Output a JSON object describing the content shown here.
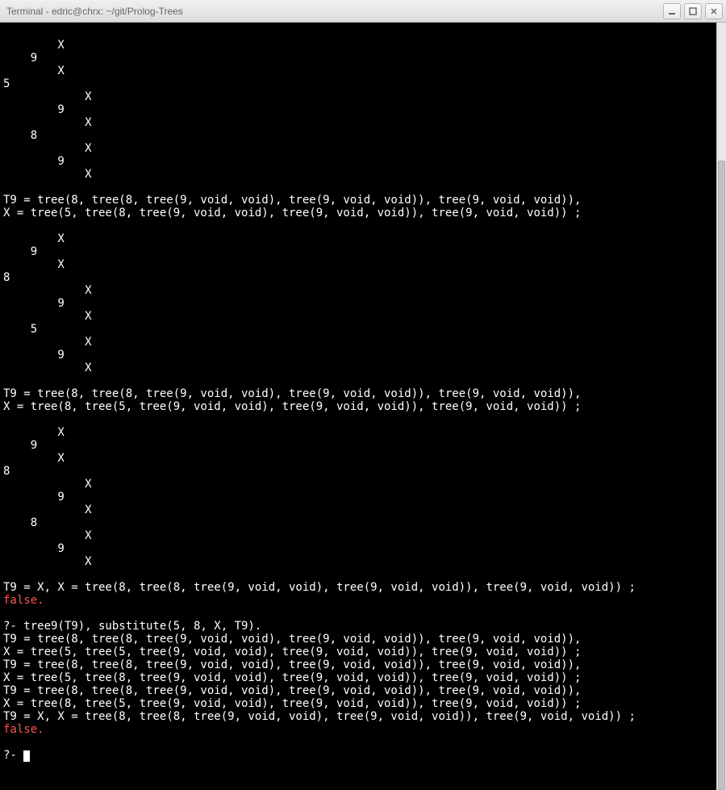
{
  "window": {
    "title": "Terminal - edric@chrx: ~/git/Prolog-Trees"
  },
  "terminal": {
    "prompt": "?- ",
    "false_text": "false.",
    "block1_tree": [
      "        X",
      "    9",
      "        X",
      "5",
      "            X",
      "        9",
      "            X",
      "    8",
      "            X",
      "        9",
      "            X",
      ""
    ],
    "block1_result": [
      "T9 = tree(8, tree(8, tree(9, void, void), tree(9, void, void)), tree(9, void, void)),",
      "X = tree(5, tree(8, tree(9, void, void), tree(9, void, void)), tree(9, void, void)) ;",
      ""
    ],
    "block2_tree": [
      "        X",
      "    9",
      "        X",
      "8",
      "            X",
      "        9",
      "            X",
      "    5",
      "            X",
      "        9",
      "            X",
      ""
    ],
    "block2_result": [
      "T9 = tree(8, tree(8, tree(9, void, void), tree(9, void, void)), tree(9, void, void)),",
      "X = tree(8, tree(5, tree(9, void, void), tree(9, void, void)), tree(9, void, void)) ;",
      ""
    ],
    "block3_tree": [
      "        X",
      "    9",
      "        X",
      "8",
      "            X",
      "        9",
      "            X",
      "    8",
      "            X",
      "        9",
      "            X",
      ""
    ],
    "block3_result": [
      "T9 = X, X = tree(8, tree(8, tree(9, void, void), tree(9, void, void)), tree(9, void, void)) ;"
    ],
    "query2": "tree9(T9), substitute(5, 8, X, T9).",
    "query2_results": [
      "T9 = tree(8, tree(8, tree(9, void, void), tree(9, void, void)), tree(9, void, void)),",
      "X = tree(5, tree(5, tree(9, void, void), tree(9, void, void)), tree(9, void, void)) ;",
      "T9 = tree(8, tree(8, tree(9, void, void), tree(9, void, void)), tree(9, void, void)),",
      "X = tree(5, tree(8, tree(9, void, void), tree(9, void, void)), tree(9, void, void)) ;",
      "T9 = tree(8, tree(8, tree(9, void, void), tree(9, void, void)), tree(9, void, void)),",
      "X = tree(8, tree(5, tree(9, void, void), tree(9, void, void)), tree(9, void, void)) ;",
      "T9 = X, X = tree(8, tree(8, tree(9, void, void), tree(9, void, void)), tree(9, void, void)) ;"
    ]
  }
}
